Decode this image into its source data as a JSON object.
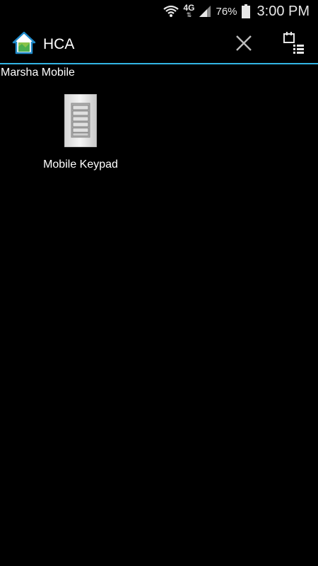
{
  "status_bar": {
    "network": "4G",
    "battery_percent": "76%",
    "time": "3:00 PM",
    "icons": [
      "wifi-icon",
      "network-4g-icon",
      "signal-icon",
      "battery-icon"
    ]
  },
  "action_bar": {
    "title": "HCA",
    "icons": [
      "hca-home-icon",
      "close-icon",
      "calendar-list-icon"
    ]
  },
  "section": {
    "title": "Marsha Mobile"
  },
  "devices": [
    {
      "label": "Mobile Keypad",
      "icon": "keypad-icon"
    }
  ],
  "colors": {
    "accent": "#33b5e5",
    "background": "#000000"
  }
}
